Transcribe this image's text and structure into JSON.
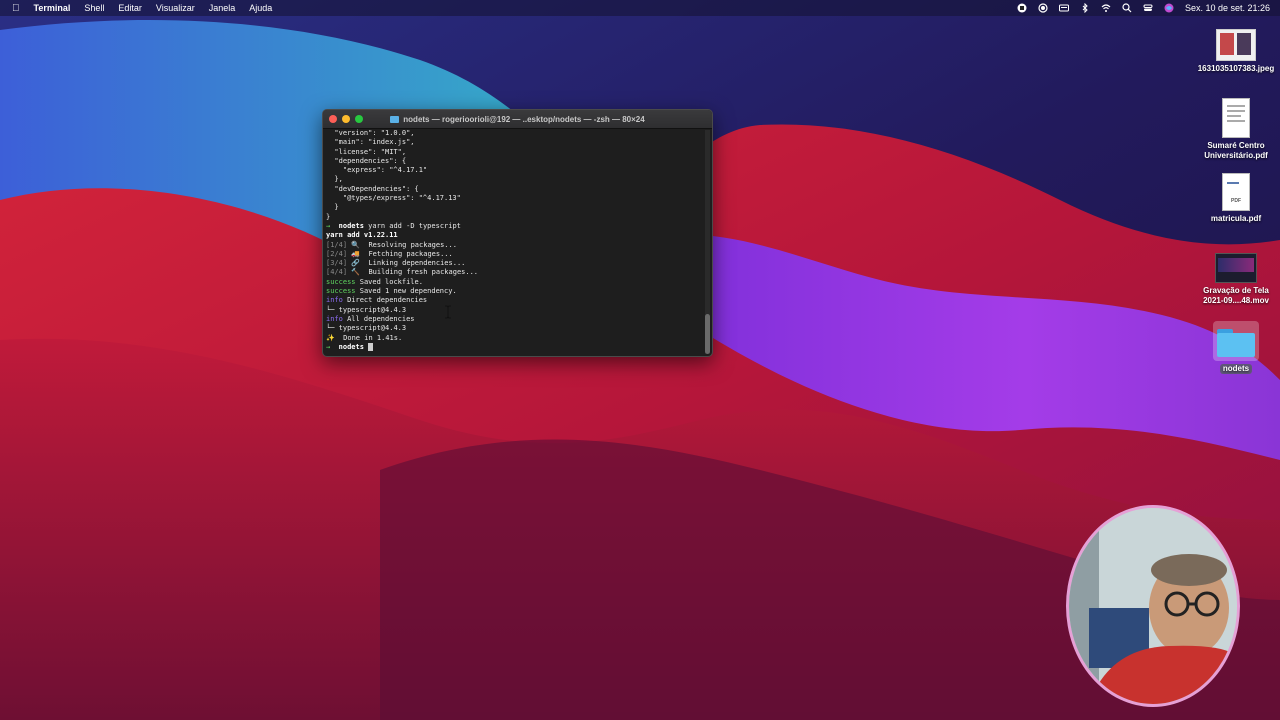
{
  "menubar": {
    "app": "Terminal",
    "items": [
      "Shell",
      "Editar",
      "Visualizar",
      "Janela",
      "Ajuda"
    ],
    "clock": "Sex. 10 de set.  21:26"
  },
  "terminal": {
    "title": "nodets — rogerioorioli@192 — ..esktop/nodets — -zsh — 80×24",
    "lines": {
      "l1": "  \"version\": \"1.0.0\",",
      "l2": "  \"main\": \"index.js\",",
      "l3": "  \"license\": \"MIT\",",
      "l4": "  \"dependencies\": {",
      "l5": "    \"express\": \"^4.17.1\"",
      "l6": "  },",
      "l7": "  \"devDependencies\": {",
      "l8": "    \"@types/express\": \"^4.17.13\"",
      "l9": "  }",
      "l10": "}",
      "prompt_dir": "nodets",
      "command": "yarn add -D typescript",
      "yarn_version": "yarn add v1.22.11",
      "step1_tag": "[1/4]",
      "step1": "Resolving packages...",
      "step2_tag": "[2/4]",
      "step2": "Fetching packages...",
      "step3_tag": "[3/4]",
      "step3": "Linking dependencies...",
      "step4_tag": "[4/4]",
      "step4": "Building fresh packages...",
      "success_tag": "success",
      "success1": "Saved lockfile.",
      "success2": "Saved 1 new dependency.",
      "info_tag": "info",
      "info1": "Direct dependencies",
      "dep1": "typescript@4.4.3",
      "info2": "All dependencies",
      "dep2": "typescript@4.4.3",
      "done": "Done in 1.41s.",
      "prompt_dir2": "nodets"
    }
  },
  "desktop": {
    "icons": [
      {
        "label": "1631035107383.jpeg"
      },
      {
        "label": "Sumaré Centro Universitário.pdf"
      },
      {
        "label": "matricula.pdf"
      },
      {
        "label": "Gravação de Tela 2021-09....48.mov"
      },
      {
        "label": "nodets"
      }
    ],
    "pdf_badge": "PDF"
  },
  "colors": {
    "accent_green": "#5fd35f",
    "accent_cyan": "#4fc1e9",
    "accent_purple": "#8c6cf0"
  }
}
